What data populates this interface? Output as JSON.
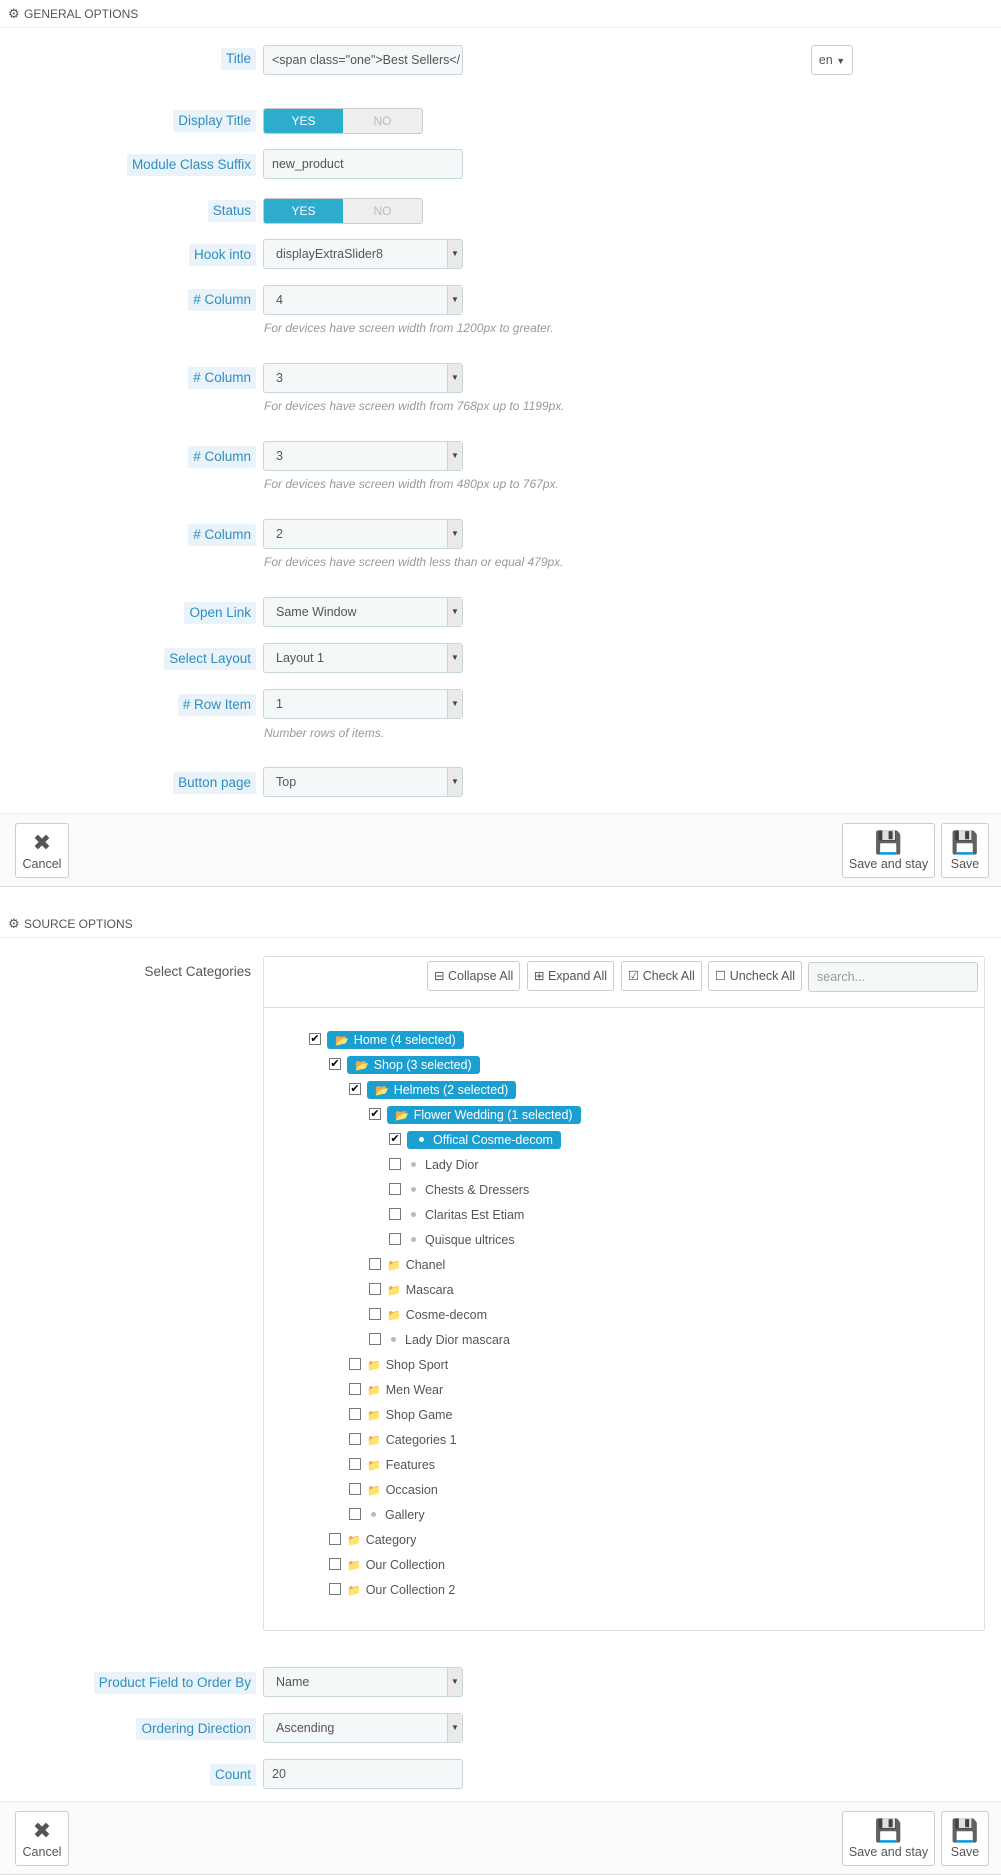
{
  "general": {
    "heading": "GENERAL OPTIONS",
    "title_label": "Title",
    "title_value": "<span class=\"one\">Best Sellers</",
    "lang": "en",
    "display_title_label": "Display Title",
    "yes": "YES",
    "no": "NO",
    "suffix_label": "Module Class Suffix",
    "suffix_value": "new_product",
    "status_label": "Status",
    "hook_label": "Hook into",
    "hook_value": "displayExtraSlider8",
    "column_label": "# Column",
    "col1_value": "4",
    "col1_help": "For devices have screen width from 1200px to greater.",
    "col2_value": "3",
    "col2_help": "For devices have screen width from 768px up to 1199px.",
    "col3_value": "3",
    "col3_help": "For devices have screen width from 480px up to 767px.",
    "col4_value": "2",
    "col4_help": "For devices have screen width less than or equal 479px.",
    "open_link_label": "Open Link",
    "open_link_value": "Same Window",
    "layout_label": "Select Layout",
    "layout_value": "Layout 1",
    "row_item_label": "# Row Item",
    "row_item_value": "1",
    "row_item_help": "Number rows of items.",
    "button_page_label": "Button page",
    "button_page_value": "Top"
  },
  "footer": {
    "cancel": "Cancel",
    "save_stay": "Save and stay",
    "save": "Save"
  },
  "source": {
    "heading": "SOURCE OPTIONS",
    "categories_label": "Select Categories",
    "collapse_all": "Collapse All",
    "expand_all": "Expand All",
    "check_all": "Check All",
    "uncheck_all": "Uncheck All",
    "search_placeholder": "search...",
    "tree": [
      {
        "label": "Home (4 selected)",
        "checked": true,
        "selected": true,
        "type": "folder-open"
      },
      {
        "label": "Shop (3 selected)",
        "checked": true,
        "selected": true,
        "type": "folder-open"
      },
      {
        "label": "Helmets (2 selected)",
        "checked": true,
        "selected": true,
        "type": "folder-open"
      },
      {
        "label": "Flower Wedding (1 selected)",
        "checked": true,
        "selected": true,
        "type": "folder-open"
      },
      {
        "label": "Offical Cosme-decom",
        "checked": true,
        "selected": true,
        "type": "leaf"
      },
      {
        "label": "Lady Dior",
        "checked": false,
        "selected": false,
        "type": "leaf"
      },
      {
        "label": "Chests & Dressers",
        "checked": false,
        "selected": false,
        "type": "leaf"
      },
      {
        "label": "Claritas Est Etiam",
        "checked": false,
        "selected": false,
        "type": "leaf"
      },
      {
        "label": "Quisque ultrices",
        "checked": false,
        "selected": false,
        "type": "leaf"
      },
      {
        "label": "Chanel",
        "checked": false,
        "selected": false,
        "type": "folder"
      },
      {
        "label": "Mascara",
        "checked": false,
        "selected": false,
        "type": "folder"
      },
      {
        "label": "Cosme-decom",
        "checked": false,
        "selected": false,
        "type": "folder"
      },
      {
        "label": "Lady Dior mascara",
        "checked": false,
        "selected": false,
        "type": "leaf"
      },
      {
        "label": "Shop Sport",
        "checked": false,
        "selected": false,
        "type": "folder"
      },
      {
        "label": "Men Wear",
        "checked": false,
        "selected": false,
        "type": "folder"
      },
      {
        "label": "Shop Game",
        "checked": false,
        "selected": false,
        "type": "folder"
      },
      {
        "label": "Categories 1",
        "checked": false,
        "selected": false,
        "type": "folder"
      },
      {
        "label": "Features",
        "checked": false,
        "selected": false,
        "type": "folder"
      },
      {
        "label": "Occasion",
        "checked": false,
        "selected": false,
        "type": "folder"
      },
      {
        "label": "Gallery",
        "checked": false,
        "selected": false,
        "type": "leaf"
      },
      {
        "label": "Category",
        "checked": false,
        "selected": false,
        "type": "folder"
      },
      {
        "label": "Our Collection",
        "checked": false,
        "selected": false,
        "type": "folder"
      },
      {
        "label": "Our Collection 2",
        "checked": false,
        "selected": false,
        "type": "folder"
      }
    ],
    "order_by_label": "Product Field to Order By",
    "order_by_value": "Name",
    "direction_label": "Ordering Direction",
    "direction_value": "Ascending",
    "count_label": "Count",
    "count_value": "20"
  }
}
